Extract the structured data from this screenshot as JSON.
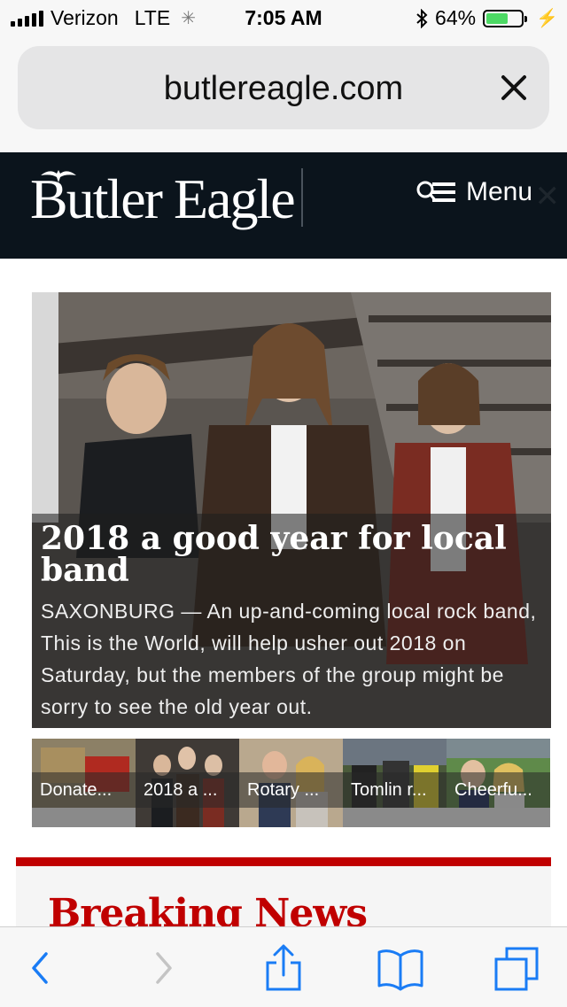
{
  "status_bar": {
    "carrier": "Verizon",
    "network": "LTE",
    "time": "7:05 AM",
    "battery_percent": "64%",
    "battery_level": 0.64
  },
  "address_bar": {
    "url": "butlereagle.com"
  },
  "site_header": {
    "logo_text": "Butler Eagle",
    "menu_label": "Menu"
  },
  "hero": {
    "title": "2018 a good year for local band",
    "summary": "SAXONBURG — An up-and-coming local rock band, This is the World, will help usher out 2018 on Saturday, but the members of the group might be sorry to see the old year out."
  },
  "thumbnails": [
    {
      "label": "Donate..."
    },
    {
      "label": "2018 a ..."
    },
    {
      "label": "Rotary ..."
    },
    {
      "label": "Tomlin r..."
    },
    {
      "label": "Cheerfu..."
    }
  ],
  "breaking_news": {
    "heading": "Breaking News"
  },
  "colors": {
    "header_bg": "#0b141c",
    "accent_red": "#c00000",
    "safari_blue": "#1a7cf5"
  },
  "toolbar": {
    "icons": [
      "back-icon",
      "forward-icon",
      "share-icon",
      "bookmarks-icon",
      "tabs-icon"
    ]
  }
}
